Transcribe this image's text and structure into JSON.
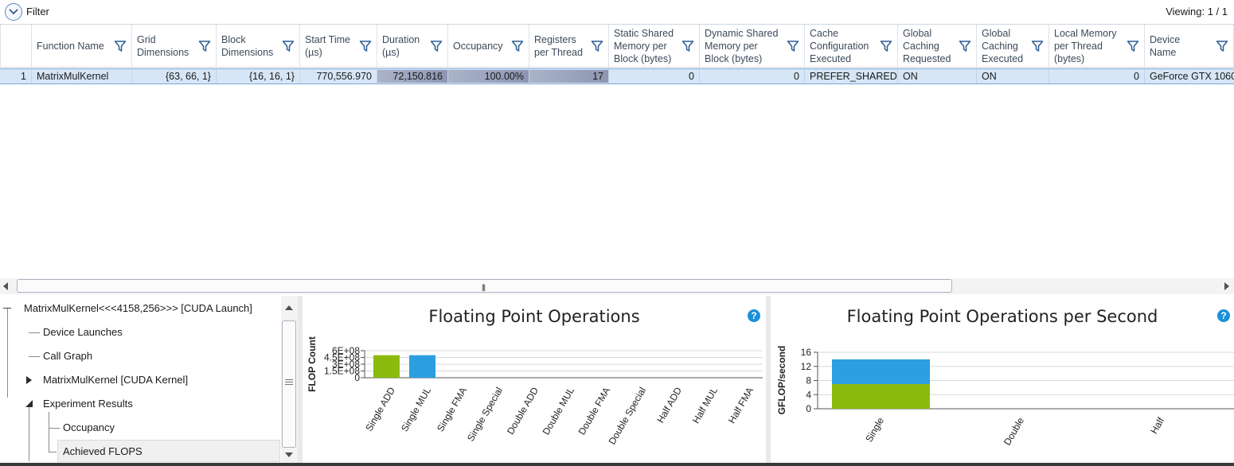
{
  "filter": {
    "label": "Filter",
    "viewing": "Viewing: 1 / 1"
  },
  "columns": [
    {
      "label": "Function Name"
    },
    {
      "label": "Grid\nDimensions"
    },
    {
      "label": "Block\nDimensions"
    },
    {
      "label": "Start Time\n(µs)"
    },
    {
      "label": "Duration\n(µs)"
    },
    {
      "label": "Occupancy"
    },
    {
      "label": "Registers\nper Thread"
    },
    {
      "label": "Static Shared\nMemory per\nBlock (bytes)"
    },
    {
      "label": "Dynamic Shared\nMemory per\nBlock (bytes)"
    },
    {
      "label": "Cache\nConfiguration\nExecuted"
    },
    {
      "label": "Global\nCaching\nRequested"
    },
    {
      "label": "Global\nCaching\nExecuted"
    },
    {
      "label": "Local Memory\nper Thread\n(bytes)"
    },
    {
      "label": "Device\nName"
    }
  ],
  "row": {
    "index": "1",
    "function_name": "MatrixMulKernel",
    "grid_dimensions": "{63, 66, 1}",
    "block_dimensions": "{16, 16, 1}",
    "start_time": "770,556.970",
    "duration": "72,150.816",
    "occupancy": "100.00%",
    "registers": "17",
    "static_shared": "0",
    "dynamic_shared": "0",
    "cache_config": "PREFER_SHARED",
    "global_caching_requested": "ON",
    "global_caching_executed": "ON",
    "local_memory": "0",
    "device_name": "GeForce GTX 1060"
  },
  "tree": {
    "root": "MatrixMulKernel<<<4158,256>>> [CUDA Launch]",
    "device_launches": "Device Launches",
    "call_graph": "Call Graph",
    "kernel": "MatrixMulKernel [CUDA Kernel]",
    "experiment_results": "Experiment Results",
    "occupancy": "Occupancy",
    "achieved_flops": "Achieved FLOPS"
  },
  "chart_data": [
    {
      "type": "bar",
      "title": "Floating Point Operations",
      "ylabel": "FLOP Count",
      "categories": [
        "Single ADD",
        "Single MUL",
        "Single FMA",
        "Single Special",
        "Double ADD",
        "Double MUL",
        "Double FMA",
        "Double Special",
        "Half ADD",
        "Half MUL",
        "Half FMA"
      ],
      "values": [
        500000000,
        500000000,
        0,
        0,
        0,
        0,
        0,
        0,
        0,
        0,
        0
      ],
      "bar_colors": [
        "#8cbb0f",
        "#2b9fe0",
        "#8cbb0f",
        "#8cbb0f",
        "#8cbb0f",
        "#8cbb0f",
        "#8cbb0f",
        "#8cbb0f",
        "#8cbb0f",
        "#8cbb0f",
        "#8cbb0f"
      ],
      "yticks": [
        "0",
        "1.5E+08",
        "3E+08",
        "4.5E+08",
        "6E+08"
      ],
      "ylim": [
        0,
        600000000
      ],
      "grid": true
    },
    {
      "type": "bar",
      "stacked": true,
      "title": "Floating Point Operations per Second",
      "ylabel": "GFLOP/second",
      "categories": [
        "Single",
        "Double",
        "Half"
      ],
      "series": [
        {
          "values": [
            7,
            0,
            0
          ],
          "color": "#8cbb0f"
        },
        {
          "values": [
            7,
            0,
            0
          ],
          "color": "#2b9fe0"
        }
      ],
      "yticks": [
        "0",
        "4",
        "8",
        "12",
        "16"
      ],
      "ylim": [
        0,
        16
      ],
      "grid": true
    }
  ],
  "help_label": "?"
}
